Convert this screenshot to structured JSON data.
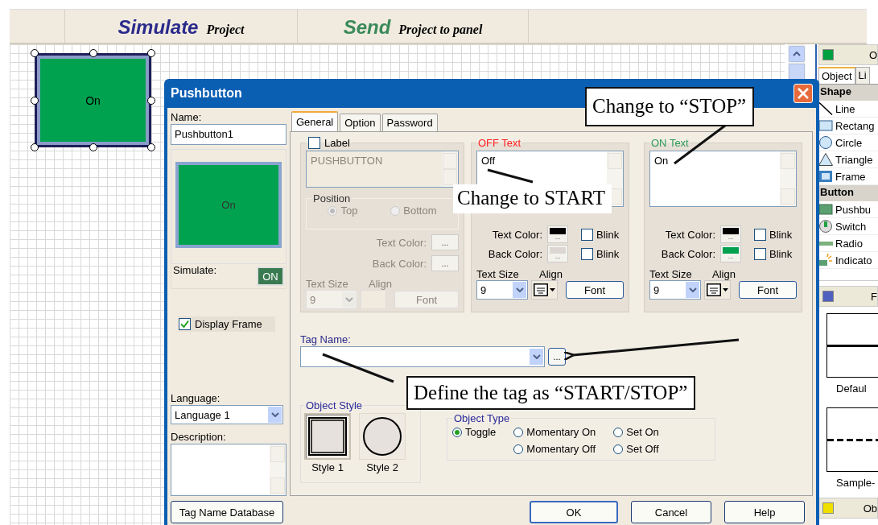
{
  "toolbar": [
    {
      "verb": "Simulate",
      "rest": "Project",
      "color": "#2a2a8c"
    },
    {
      "verb": "Send",
      "rest": "Project to panel",
      "color": "#3a8a5a"
    }
  ],
  "canvas_object": {
    "text": "On"
  },
  "dialog": {
    "title": "Pushbutton",
    "name_label": "Name:",
    "name_value": "Pushbutton1",
    "preview_text": "On",
    "simulate_label": "Simulate:",
    "simulate_value": "ON",
    "display_frame": {
      "label": "Display Frame",
      "checked": true
    },
    "language_label": "Language:",
    "language_value": "Language 1",
    "description_label": "Description:",
    "tag_db_button": "Tag Name Database",
    "tabs": [
      {
        "label": "General",
        "selected": true
      },
      {
        "label": "Option",
        "selected": false
      },
      {
        "label": "Password",
        "selected": false
      }
    ],
    "label_group": {
      "label": "Label",
      "checked": false,
      "disabled": true,
      "value": "PUSHBUTTON",
      "position_label": "Position",
      "positions": [
        {
          "label": "Top",
          "selected": true
        },
        {
          "label": "Bottom",
          "selected": false
        }
      ],
      "text_color_label": "Text Color:",
      "back_color_label": "Back Color:",
      "ellipsis": "...",
      "text_size_label": "Text Size",
      "text_size": "9",
      "align_label": "Align",
      "font_button": "Font"
    },
    "text_groups": [
      {
        "title": "OFF Text",
        "color": "#ff2020",
        "value": "Off",
        "swatches": [
          {
            "label": "Text Color:",
            "color": "#000000",
            "ellipsis": "...",
            "blink": "Blink",
            "checked": false
          },
          {
            "label": "Back Color:",
            "color": "#dcd6d2",
            "ellipsis": "...",
            "blink": "Blink",
            "checked": false
          }
        ],
        "text_size_label": "Text Size",
        "text_size": "9",
        "align_label": "Align",
        "font_button": "Font"
      },
      {
        "title": "ON Text",
        "color": "#2e9a5a",
        "value": "On",
        "swatches": [
          {
            "label": "Text Color:",
            "color": "#000000",
            "ellipsis": "...",
            "blink": "Blink",
            "checked": false
          },
          {
            "label": "Back Color:",
            "color": "#00a050",
            "ellipsis": "...",
            "blink": "Blink",
            "checked": false
          }
        ],
        "text_size_label": "Text Size",
        "text_size": "9",
        "align_label": "Align",
        "font_button": "Font"
      }
    ],
    "tag_name_label": "Tag Name:",
    "tag_browse": "...",
    "object_style": {
      "title": "Object Style",
      "styles": [
        {
          "label": "Style 1",
          "kind": "square",
          "selected": true
        },
        {
          "label": "Style 2",
          "kind": "circle",
          "selected": false
        }
      ]
    },
    "object_type": {
      "title": "Object Type",
      "columns": [
        [
          {
            "label": "Toggle",
            "selected": true
          }
        ],
        [
          {
            "label": "Momentary On",
            "selected": false
          },
          {
            "label": "Momentary Off",
            "selected": false
          }
        ],
        [
          {
            "label": "Set On",
            "selected": false
          },
          {
            "label": "Set Off",
            "selected": false
          }
        ]
      ]
    },
    "buttons": [
      "OK",
      "Cancel",
      "Help"
    ]
  },
  "right_panel": {
    "header": {
      "text": "O",
      "color": "#00a040"
    },
    "tabs": [
      {
        "label": "Object",
        "selected": true
      },
      {
        "label": "Li",
        "selected": false
      }
    ],
    "sections": [
      {
        "title": "Shape",
        "items": [
          {
            "label": "Line",
            "kind": "line"
          },
          {
            "label": "Rectang",
            "kind": "rect"
          },
          {
            "label": "Circle",
            "kind": "circle"
          },
          {
            "label": "Triangle",
            "kind": "triangle"
          },
          {
            "label": "Frame",
            "kind": "frame"
          }
        ]
      },
      {
        "title": "Button",
        "items": [
          {
            "label": "Pushbu",
            "kind": "pushbutton"
          },
          {
            "label": "Switch",
            "kind": "switch"
          },
          {
            "label": "Radio",
            "kind": "radio"
          },
          {
            "label": "Indicato",
            "kind": "indicator"
          }
        ]
      }
    ],
    "header2": {
      "text": "F",
      "color": "#5060c0"
    },
    "previews": [
      {
        "label": "Defaul",
        "kind": "solid"
      },
      {
        "label": "Sample-",
        "kind": "dashed"
      }
    ],
    "footer": {
      "text": "Ob",
      "color": "#f0e000"
    }
  },
  "callouts": [
    {
      "text": "Change to “STOP”",
      "kind": "stop"
    },
    {
      "text": "Change to START",
      "kind": "start"
    },
    {
      "text": "Define the tag as “START/STOP”",
      "kind": "tag"
    }
  ]
}
